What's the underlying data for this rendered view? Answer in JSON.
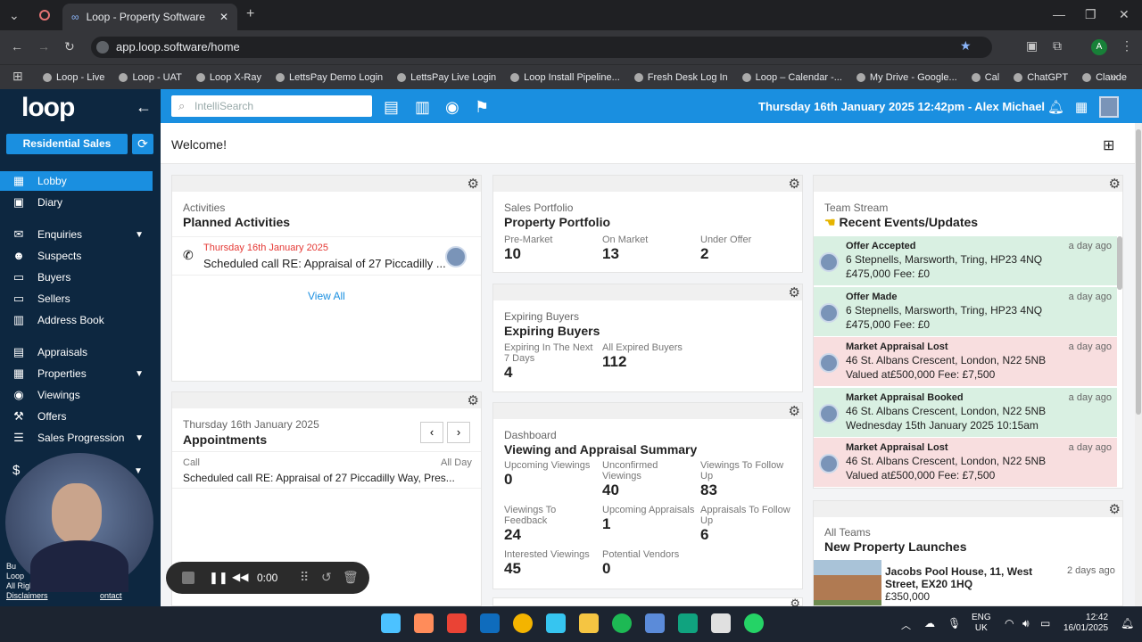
{
  "browser": {
    "tab_title": "Loop - Property Software",
    "url": "app.loop.software/home",
    "bookmarks": [
      "Loop - Live",
      "Loop - UAT",
      "Loop X-Ray",
      "LettsPay Demo Login",
      "LettsPay Live Login",
      "Loop Install Pipeline...",
      "Fresh Desk Log In",
      "Loop – Calendar -...",
      "My Drive - Google...",
      "Cal",
      "ChatGPT",
      "Claude"
    ],
    "profile_initial": "A"
  },
  "app": {
    "logo": "loop",
    "branch": "Residential Sales",
    "search_placeholder": "IntelliSearch",
    "datetime_user": "Thursday 16th January 2025 12:42pm - Alex Michael",
    "welcome": "Welcome!",
    "nav": [
      {
        "label": "Lobby",
        "icon": "grid-icon",
        "active": true
      },
      {
        "label": "Diary",
        "icon": "calendar-icon"
      },
      {
        "label": "Enquiries",
        "icon": "chat-icon",
        "chevron": true
      },
      {
        "label": "Suspects",
        "icon": "user-icon"
      },
      {
        "label": "Buyers",
        "icon": "id-card-icon"
      },
      {
        "label": "Sellers",
        "icon": "id-card-icon"
      },
      {
        "label": "Address Book",
        "icon": "book-icon"
      },
      {
        "label": "Appraisals",
        "icon": "clipboard-icon"
      },
      {
        "label": "Properties",
        "icon": "building-icon",
        "chevron": true
      },
      {
        "label": "Viewings",
        "icon": "eye-icon"
      },
      {
        "label": "Offers",
        "icon": "gavel-icon"
      },
      {
        "label": "Sales Progression",
        "icon": "progress-icon",
        "chevron": true
      }
    ],
    "footer_lines": [
      "Bu",
      "Loop",
      "All Righ",
      "Disclaimers",
      "ontact"
    ]
  },
  "activities": {
    "sub": "Activities",
    "title": "Planned Activities",
    "date": "Thursday 16th January 2025",
    "text": "Scheduled call RE: Appraisal of 27 Piccadilly ...",
    "view_all": "View All"
  },
  "appointments": {
    "sub": "Thursday 16th January 2025",
    "title": "Appointments",
    "type": "Call",
    "allday": "All Day",
    "text": "Scheduled call RE: Appraisal of 27 Piccadilly Way, Pres..."
  },
  "portfolio": {
    "sub": "Sales Portfolio",
    "title": "Property Portfolio",
    "stats": [
      {
        "label": "Pre-Market",
        "value": "10"
      },
      {
        "label": "On Market",
        "value": "13"
      },
      {
        "label": "Under Offer",
        "value": "2"
      }
    ]
  },
  "expiring": {
    "sub": "Expiring Buyers",
    "title": "Expiring Buyers",
    "stats": [
      {
        "label": "Expiring In The Next 7 Days",
        "value": "4"
      },
      {
        "label": "All Expired Buyers",
        "value": "112"
      }
    ]
  },
  "dashboard": {
    "sub": "Dashboard",
    "title": "Viewing and Appraisal Summary",
    "stats": [
      {
        "label": "Upcoming Viewings",
        "value": "0"
      },
      {
        "label": "Unconfirmed Viewings",
        "value": "40"
      },
      {
        "label": "Viewings To Follow Up",
        "value": "83"
      },
      {
        "label": "Viewings To Feedback",
        "value": "24"
      },
      {
        "label": "Upcoming Appraisals",
        "value": "1"
      },
      {
        "label": "Appraisals To Follow Up",
        "value": "6"
      },
      {
        "label": "Interested Viewings",
        "value": "45"
      },
      {
        "label": "Potential Vendors",
        "value": "0"
      }
    ]
  },
  "team": {
    "sub": "Team Stream",
    "title": "Recent Events/Updates",
    "events": [
      {
        "type": "Offer Accepted",
        "a": "6 Stepnells, Marsworth, Tring, HP23 4NQ",
        "b": "£475,000 Fee: £0",
        "when": "a day ago",
        "color": "#d9f0e2"
      },
      {
        "type": "Offer Made",
        "a": "6 Stepnells, Marsworth, Tring, HP23 4NQ",
        "b": "£475,000 Fee: £0",
        "when": "a day ago",
        "color": "#d9f0e2"
      },
      {
        "type": "Market Appraisal Lost",
        "a": "46 St. Albans Crescent, London, N22 5NB",
        "b": "Valued at£500,000 Fee: £7,500",
        "when": "a day ago",
        "color": "#f8dedf"
      },
      {
        "type": "Market Appraisal Booked",
        "a": "46 St. Albans Crescent, London, N22 5NB",
        "b": "Wednesday 15th January 2025 10:15am",
        "when": "a day ago",
        "color": "#d9f0e2"
      },
      {
        "type": "Market Appraisal Lost",
        "a": "46 St. Albans Crescent, London, N22 5NB",
        "b": "Valued at£500,000 Fee: £7,500",
        "when": "a day ago",
        "color": "#f8dedf"
      }
    ]
  },
  "launches": {
    "sub": "All Teams",
    "title": "New Property Launches",
    "name": "Jacobs Pool House, 11, West Street, EX20 1HQ",
    "price": "£350,000",
    "when": "2 days ago"
  },
  "recorder": {
    "time": "0:00"
  },
  "taskbar": {
    "lang1": "ENG",
    "lang2": "UK",
    "time": "12:42",
    "date": "16/01/2025"
  }
}
